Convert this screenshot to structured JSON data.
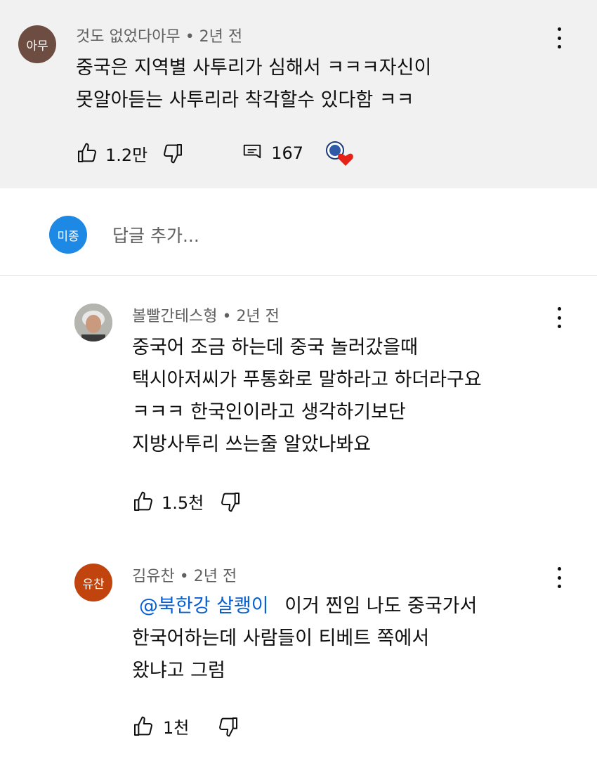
{
  "main_comment": {
    "avatar_text": "아무",
    "avatar_color": "#6d4c41",
    "author": "것도 없었다아무",
    "time": "2년 전",
    "text_lines": [
      "중국은 지역별 사투리가 심해서 ㅋㅋㅋ자신이",
      "못알아듣는 사투리라 착각할수 있다함 ㅋㅋ"
    ],
    "likes": "1.2만",
    "replies_count": "167",
    "creator_badge": "creator-heart-icon"
  },
  "reply_box": {
    "avatar_text": "미종",
    "avatar_color": "#1e88e5",
    "placeholder": "답글 추가..."
  },
  "replies": [
    {
      "author": "볼빨간테스형",
      "time": "2년 전",
      "text_lines": [
        "중국어 조금 하는데 중국 놀러갔을때",
        "택시아저씨가 푸통화로 말하라고 하더라구요",
        "ㅋㅋㅋ 한국인이라고 생각하기보단",
        "지방사투리 쓰는줄 알았나봐요"
      ],
      "likes": "1.5천"
    },
    {
      "avatar_text": "유찬",
      "avatar_color": "#c1440e",
      "author": "김유찬",
      "time": "2년 전",
      "mention": "@북한강 살쾡이",
      "text_first": "이거 찐임 나도 중국가서",
      "text_lines": [
        "한국어하는데 사람들이 티베트 쪽에서",
        "왔냐고 그럼"
      ],
      "likes": "1천"
    }
  ],
  "separator": "•",
  "colors": {
    "top_bg": "#f1f1f1",
    "meta": "#606060",
    "link": "#065fd4",
    "heart": "#e62117"
  }
}
